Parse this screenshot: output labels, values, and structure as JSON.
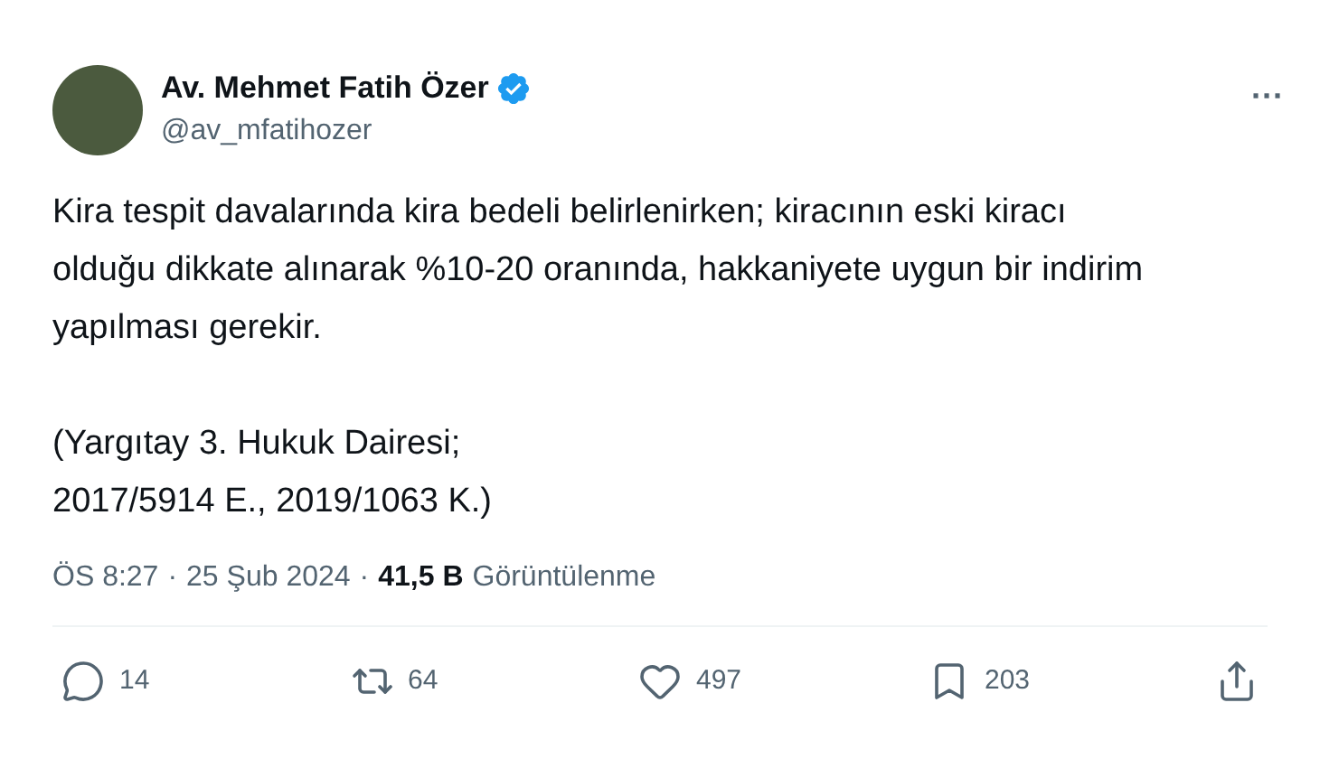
{
  "author": {
    "name": "Av. Mehmet Fatih Özer",
    "handle": "@av_mfatihozer",
    "verified": true
  },
  "more": "···",
  "paragraphs": [
    [
      "Kira tespit davalarında kira bedeli belirlenirken; kiracının eski kiracı",
      "olduğu dikkate alınarak %10-20 oranında, hakkaniyete uygun bir indirim",
      "yapılması gerekir."
    ],
    [
      "(Yargıtay 3. Hukuk Dairesi;",
      "2017/5914 E., 2019/1063 K.)"
    ]
  ],
  "meta": {
    "time": "ÖS 8:27",
    "sep_1": "·",
    "date": "25 Şub 2024",
    "sep_2": "·",
    "views": "41,5 B",
    "views_label": "Görüntülenme"
  },
  "actions": [
    {
      "kind": "reply",
      "count": "14"
    },
    {
      "kind": "repost",
      "count": "64"
    },
    {
      "kind": "like",
      "count": "497"
    },
    {
      "kind": "bookmark",
      "count": "203"
    },
    {
      "kind": "share"
    }
  ]
}
